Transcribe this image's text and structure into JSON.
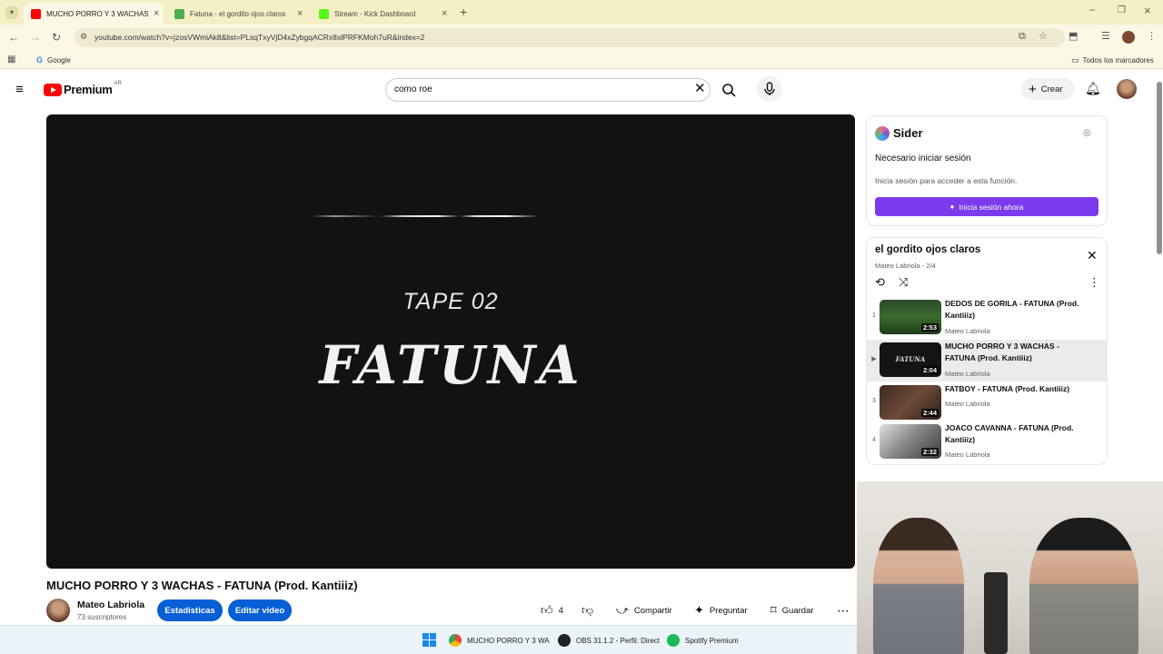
{
  "browser": {
    "tabs": [
      {
        "label": "MUCHO PORRO Y 3 WACHAS -",
        "active": true,
        "favicon_color": "#ff0000"
      },
      {
        "label": "Fatuna - el gordito ojos claros",
        "active": false,
        "favicon_color": "#4caf50"
      },
      {
        "label": "Stream - Kick Dashboard",
        "active": false,
        "favicon_color": "#53fc18"
      }
    ],
    "new_tab_icon": "+",
    "url": "youtube.com/watch?v=jzosVWmiAk8&list=PLsqTxyVjD4xZybgqACRx8xlPRFKMoh7uR&index=2",
    "bookmark_google": "Google",
    "bookmarks_all": "Todos los marcadores",
    "chrome_color": "#f4efc6"
  },
  "youtube": {
    "logo_word": "Premium",
    "country_code": "AR",
    "search_value": "como roe",
    "create_label": "Crear",
    "accent": "#ff0000"
  },
  "video": {
    "screen_tape": "TAPE 02",
    "screen_title": "FATUNA",
    "title": "MUCHO PORRO Y 3 WACHAS - FATUNA (Prod. Kantiiiz)",
    "channel": "Mateo Labriola",
    "subscribers": "73 suscriptores",
    "stats_btn": "Estadísticas",
    "edit_btn": "Editar video",
    "likes": "4",
    "share": "Compartir",
    "ask": "Preguntar",
    "save": "Guardar"
  },
  "sider": {
    "name": "Sider",
    "heading": "Necesario iniciar sesión",
    "desc": "Inicia sesión para acceder a esta función.",
    "button": "Inicia sesión ahora",
    "accent": "#7c3aed"
  },
  "playlist": {
    "title": "el gordito ojos claros",
    "subtitle": "Mateo Labriola - 2/4",
    "items": [
      {
        "index": "1",
        "title": "DEDOS DE GORILA - FATUNA (Prod. Kantiiiz)",
        "channel": "Mateo Labriola",
        "duration": "2:53",
        "active": false
      },
      {
        "index": "▶",
        "title": "MUCHO PORRO Y 3 WACHAS - FATUNA (Prod. Kantiiiz)",
        "channel": "Mateo Labriola",
        "duration": "2:04",
        "active": true
      },
      {
        "index": "3",
        "title": "FATBOY - FATUNA (Prod. Kantiiiz)",
        "channel": "Mateo Labriola",
        "duration": "2:44",
        "active": false
      },
      {
        "index": "4",
        "title": "JOACO CAVANNA - FATUNA (Prod. Kantiiiz)",
        "channel": "Mateo Labriola",
        "duration": "2:32",
        "active": false
      }
    ]
  },
  "taskbar": {
    "items": [
      {
        "label": "MUCHO PORRO Y 3 WA",
        "icon": "chrome-icon"
      },
      {
        "label": "OBS 31.1.2 - Perfil: Direct",
        "icon": "obs-icon"
      },
      {
        "label": "Spotify Premium",
        "icon": "spotify-icon"
      }
    ]
  }
}
